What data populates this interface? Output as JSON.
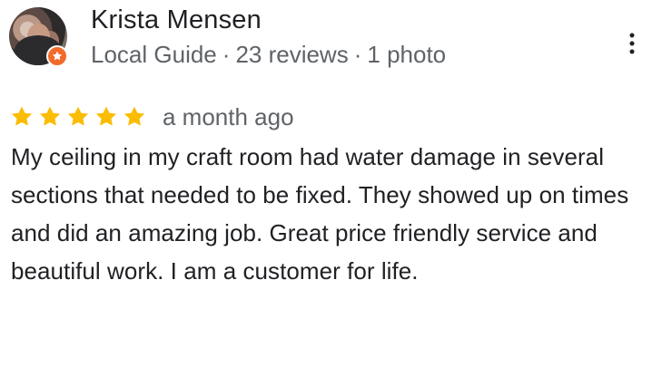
{
  "reviewer": {
    "name": "Krista Mensen",
    "badge_icon": "local-guide-star-icon",
    "meta": {
      "role": "Local Guide",
      "separator": "·",
      "reviews": "23 reviews",
      "photos": "1 photo"
    }
  },
  "rating": {
    "stars": 5,
    "star_icon": "star-icon",
    "time": "a month ago"
  },
  "review": {
    "text": "My ceiling in my craft room had water damage in several sections that needed to be fixed. They showed up on times and did an amazing job. Great price friendly service and beautiful work. I am a customer for life."
  },
  "menu": {
    "icon": "more-vert-icon"
  },
  "colors": {
    "primary_text": "#202124",
    "secondary_text": "#5f6368",
    "star": "#fbbc04",
    "local_guide_badge": "#f26b2b"
  }
}
